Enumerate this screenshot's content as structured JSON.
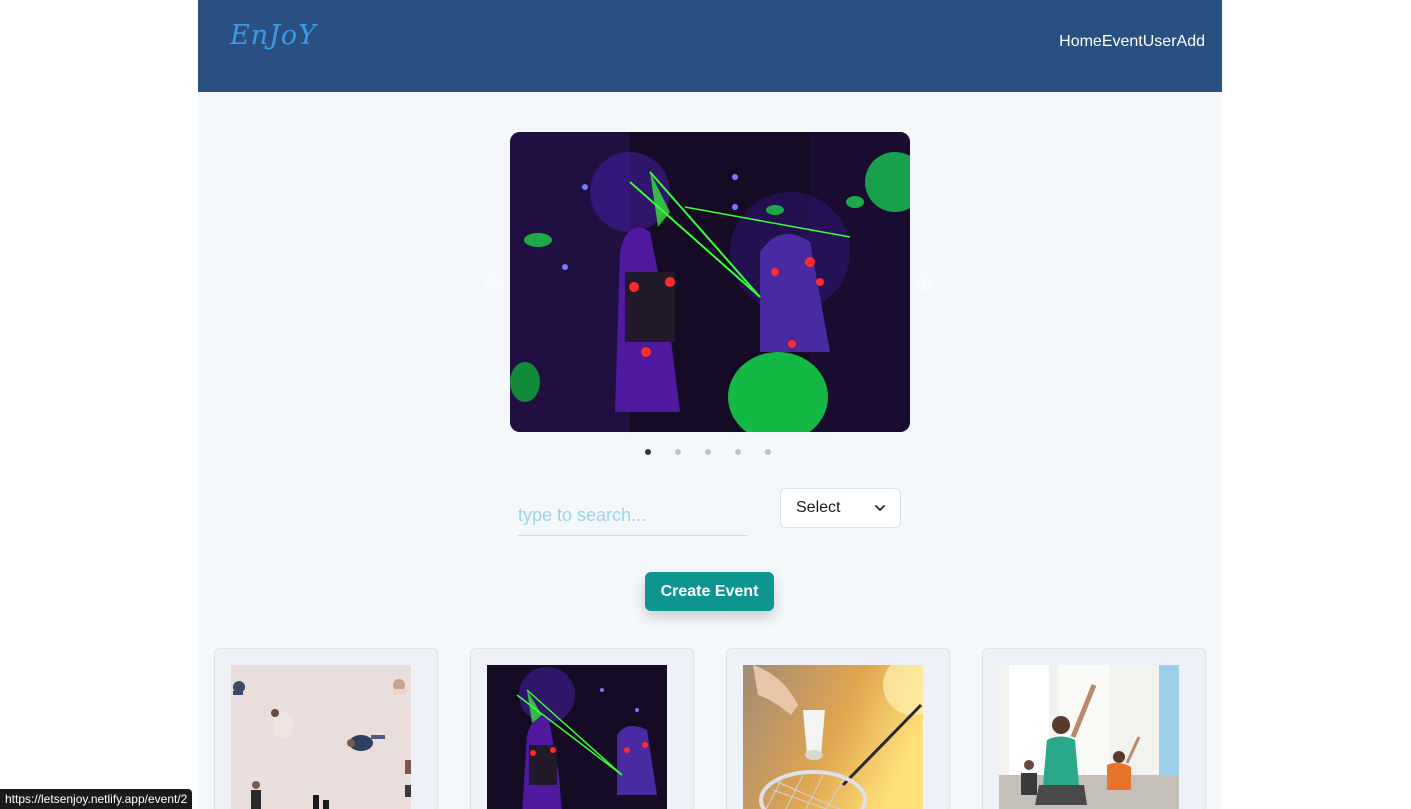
{
  "header": {
    "logo": "EnJoY",
    "nav": [
      "Home",
      "Event",
      "User",
      "Add"
    ]
  },
  "carousel": {
    "slide_count": 5,
    "active_index": 0
  },
  "search": {
    "placeholder": "type to search..."
  },
  "filter": {
    "selected": "Select"
  },
  "create_button": "Create Event",
  "status_url": "https://letsenjoy.netlify.app/event/2",
  "colors": {
    "header_bg": "#2a5082",
    "logo": "#3b9ce6",
    "accent_button": "#0d9690",
    "page_bg": "#f5f8fb"
  },
  "cards": [
    {
      "image": "falling-people-photo"
    },
    {
      "image": "laser-tag-photo"
    },
    {
      "image": "badminton-photo"
    },
    {
      "image": "yoga-class-photo"
    }
  ]
}
